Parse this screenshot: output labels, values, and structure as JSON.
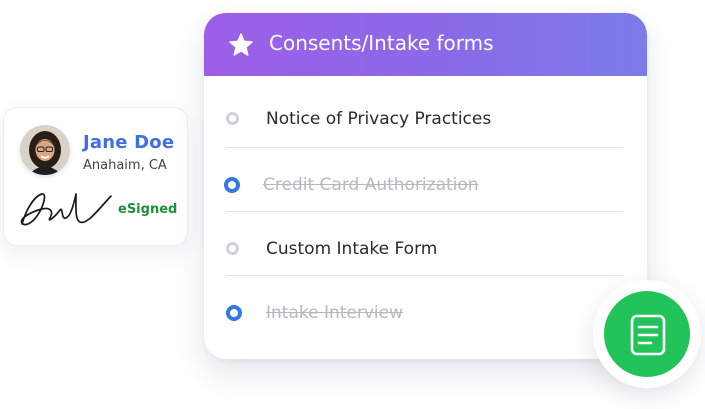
{
  "profile": {
    "name": "Jane Doe",
    "location": "Anahaim, CA",
    "status": "eSigned"
  },
  "forms_card": {
    "title": "Consents/Intake forms",
    "items": [
      {
        "label": "Notice of Privacy Practices",
        "state": "unchecked"
      },
      {
        "label": "Credit Card Authorization",
        "state": "completed"
      },
      {
        "label": "Custom Intake Form",
        "state": "unchecked"
      },
      {
        "label": "Intake Interview",
        "state": "completed"
      }
    ]
  },
  "icons": {
    "header": "star-icon",
    "fab": "document-icon",
    "signature": "signature-image"
  },
  "colors": {
    "header_gradient_start": "#9d5ee8",
    "header_gradient_end": "#7b7ce9",
    "name_blue": "#3f6fe0",
    "esigned_green": "#1f8f3a",
    "radio_active": "#3279e6",
    "fab_green": "#22c45a"
  }
}
